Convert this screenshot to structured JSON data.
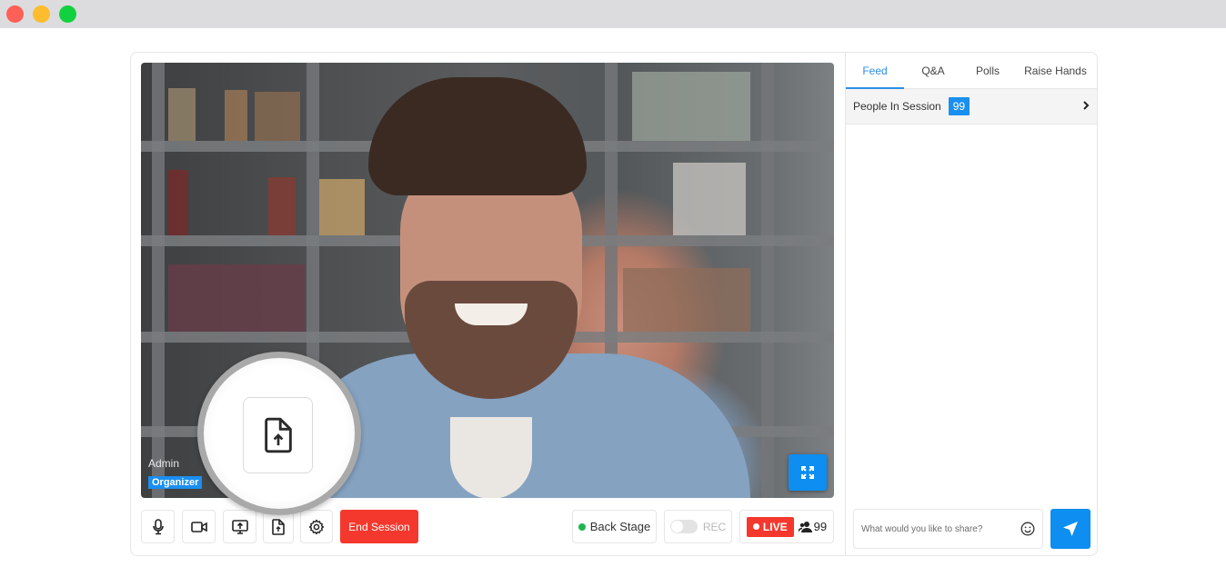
{
  "window": {
    "controls": [
      "close",
      "minimize",
      "maximize"
    ]
  },
  "video": {
    "participant_name": "Admin",
    "role_badge": "Organizer",
    "expand_icon": "expand-arrows-icon"
  },
  "highlight": {
    "icon": "file-upload-icon"
  },
  "controls": {
    "buttons": [
      {
        "name": "microphone",
        "icon": "microphone-icon"
      },
      {
        "name": "camera",
        "icon": "video-camera-icon"
      },
      {
        "name": "share-screen",
        "icon": "screen-share-icon"
      },
      {
        "name": "upload-file",
        "icon": "file-upload-icon"
      },
      {
        "name": "settings",
        "icon": "gear-icon"
      }
    ],
    "end_session_label": "End Session",
    "back_stage_label": "Back Stage",
    "rec_label": "REC",
    "rec_enabled": false,
    "live_label": "LIVE",
    "viewer_count": "99"
  },
  "sidebar": {
    "tabs": [
      {
        "label": "Feed",
        "active": true
      },
      {
        "label": "Q&A",
        "active": false
      },
      {
        "label": "Polls",
        "active": false
      },
      {
        "label": "Raise Hands",
        "active": false
      }
    ],
    "people_label": "People In Session",
    "people_count": "99",
    "chat_placeholder": "What would you like to share?",
    "chat_value": ""
  },
  "colors": {
    "accent": "#0d8ef0",
    "danger": "#f4382d",
    "online": "#1fb552"
  }
}
